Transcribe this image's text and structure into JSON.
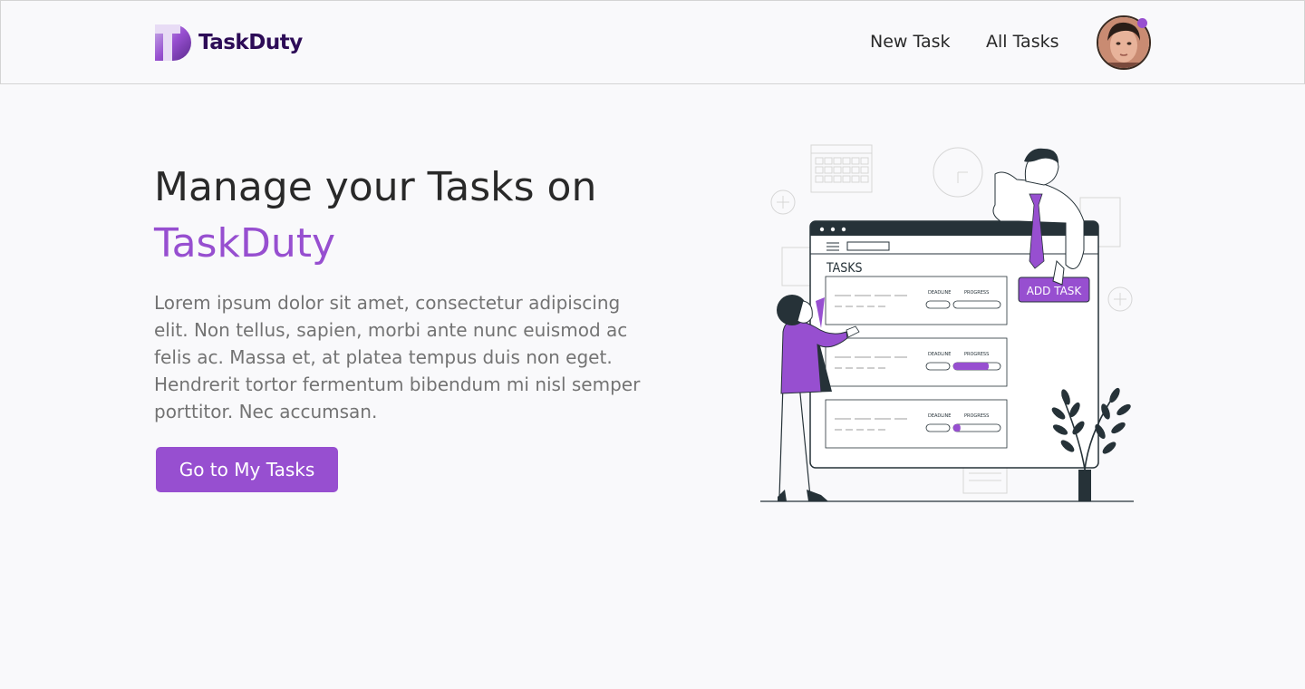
{
  "colors": {
    "accent": "#974fd0",
    "brand_dark": "#2d0c57",
    "text": "#292929",
    "muted": "#737373",
    "background": "#f9f9fb"
  },
  "header": {
    "brand_name": "TaskDuty",
    "logo_icon": "taskduty-logo-icon",
    "nav": {
      "new_task": "New Task",
      "all_tasks": "All Tasks"
    },
    "avatar_icon": "user-avatar"
  },
  "hero": {
    "title_line1": "Manage your Tasks on",
    "title_line2": "TaskDuty",
    "description": "Lorem ipsum dolor sit amet, consectetur adipiscing elit. Non tellus, sapien, morbi ante nunc euismod ac felis ac. Massa et, at platea tempus duis non eget. Hendrerit tortor fermentum bibendum mi nisl semper porttitor. Nec accumsan.",
    "cta_label": "Go to My Tasks"
  },
  "illustration": {
    "panel_title": "TASKS",
    "add_button": "ADD TASK",
    "deadline_label": "DEADLINE",
    "progress_label": "PROGRESS",
    "rows": [
      {
        "progress": 0
      },
      {
        "progress": 0.75
      },
      {
        "progress": 0.15
      }
    ]
  }
}
